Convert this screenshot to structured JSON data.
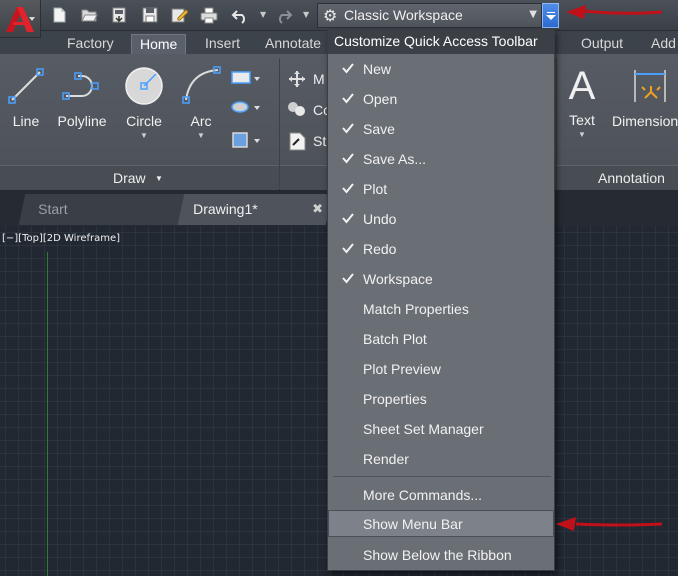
{
  "quick_access_toolbar": {
    "icons": [
      "new-icon",
      "open-icon",
      "save-to-cloud-icon",
      "save-icon",
      "save-as-icon",
      "plot-icon",
      "undo-icon",
      "redo-icon"
    ],
    "workspace_label": "Classic Workspace"
  },
  "ribbon_tabs": [
    "Factory",
    "Home",
    "Insert",
    "Annotate",
    "Output",
    "Add"
  ],
  "ribbon_tools": {
    "line": "Line",
    "polyline": "Polyline",
    "circle": "Circle",
    "arc": "Arc",
    "text": "Text",
    "dimension": "Dimension",
    "modify_partial_1": "M",
    "modify_partial_2": "Co",
    "modify_partial_3": "St",
    "text_glyph": "A"
  },
  "panels": {
    "draw": "Draw",
    "annotation": "Annotation"
  },
  "doc_tabs": {
    "start": "Start",
    "drawing": "Drawing1*",
    "close_glyph": "✖"
  },
  "viewport_label": "[−][Top][2D Wireframe]",
  "menu": {
    "title": "Customize Quick Access Toolbar",
    "items": [
      {
        "label": "New",
        "checked": true
      },
      {
        "label": "Open",
        "checked": true
      },
      {
        "label": "Save",
        "checked": true
      },
      {
        "label": "Save As...",
        "checked": true
      },
      {
        "label": "Plot",
        "checked": true
      },
      {
        "label": "Undo",
        "checked": true
      },
      {
        "label": "Redo",
        "checked": true
      },
      {
        "label": "Workspace",
        "checked": true
      },
      {
        "label": "Match Properties",
        "checked": false
      },
      {
        "label": "Batch Plot",
        "checked": false
      },
      {
        "label": "Plot Preview",
        "checked": false
      },
      {
        "label": "Properties",
        "checked": false
      },
      {
        "label": "Sheet Set Manager",
        "checked": false
      },
      {
        "label": "Render",
        "checked": false
      }
    ],
    "more_commands": "More Commands...",
    "show_menu_bar": "Show Menu Bar",
    "show_below_ribbon": "Show Below the Ribbon"
  },
  "colors": {
    "accent_blue": "#3a7ae0",
    "annotation_arrow": "#c0111a",
    "ucs_axis_green": "#2f7a35"
  }
}
